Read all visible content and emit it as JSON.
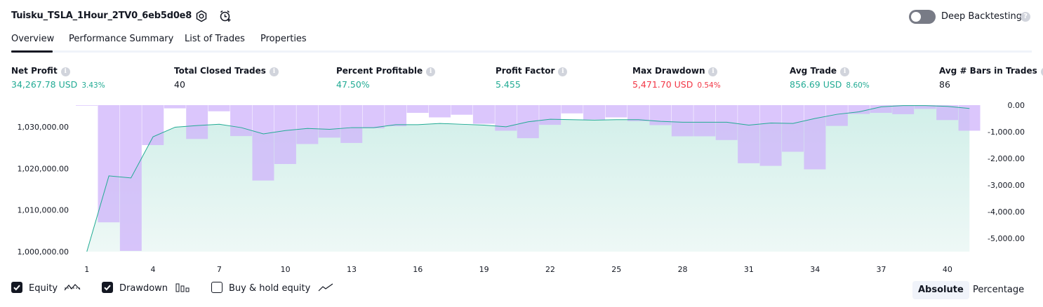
{
  "header": {
    "strategy_title": "Tuisku_TSLA_1Hour_2TV0_6eb5d0e8",
    "deep_backtesting_label": "Deep Backtesting",
    "deep_backtesting_on": false,
    "help_glyph": "?"
  },
  "tabs": [
    {
      "label": "Overview",
      "active": true
    },
    {
      "label": "Performance Summary",
      "active": false
    },
    {
      "label": "List of Trades",
      "active": false
    },
    {
      "label": "Properties",
      "active": false
    }
  ],
  "metrics": [
    {
      "label": "Net Profit",
      "value": "34,267.78 USD",
      "sub": "3.43%",
      "tone": "green"
    },
    {
      "label": "Total Closed Trades",
      "value": "40",
      "sub": "",
      "tone": "neutral"
    },
    {
      "label": "Percent Profitable",
      "value": "47.50%",
      "sub": "",
      "tone": "green"
    },
    {
      "label": "Profit Factor",
      "value": "5.455",
      "sub": "",
      "tone": "green"
    },
    {
      "label": "Max Drawdown",
      "value": "5,471.70 USD",
      "sub": "0.54%",
      "tone": "red"
    },
    {
      "label": "Avg Trade",
      "value": "856.69 USD",
      "sub": "8.60%",
      "tone": "green"
    },
    {
      "label": "Avg # Bars in Trades",
      "value": "86",
      "sub": "",
      "tone": "neutral"
    }
  ],
  "info_glyph": "i",
  "chart_data": {
    "type": "area",
    "left_axis": {
      "ticks": [
        "1,030,000.00",
        "1,020,000.00",
        "1,010,000.00",
        "1,000,000.00"
      ],
      "tick_values": [
        1030000,
        1020000,
        1010000,
        1000000
      ],
      "range": [
        1000000,
        1035200
      ]
    },
    "right_axis": {
      "ticks": [
        "0.00",
        "-1,000.00",
        "-2,000.00",
        "-3,000.00",
        "-4,000.00",
        "-5,000.00"
      ],
      "tick_values": [
        0,
        -1000,
        -2000,
        -3000,
        -4000,
        -5000
      ],
      "range": [
        -5500,
        0
      ]
    },
    "x_ticks": [
      "1",
      "4",
      "7",
      "10",
      "13",
      "16",
      "19",
      "22",
      "25",
      "28",
      "31",
      "34",
      "37",
      "40"
    ],
    "x_tick_values": [
      1,
      4,
      7,
      10,
      13,
      16,
      19,
      22,
      25,
      28,
      31,
      34,
      37,
      40
    ],
    "x_range": [
      0.5,
      41.5
    ],
    "series": [
      {
        "name": "Equity",
        "type": "area",
        "color": "#22ab94",
        "fill": "#d1efe9",
        "x": [
          1,
          2,
          3,
          4,
          5,
          6,
          7,
          8,
          9,
          10,
          11,
          12,
          13,
          14,
          15,
          16,
          17,
          18,
          19,
          20,
          21,
          22,
          23,
          24,
          25,
          26,
          27,
          28,
          29,
          30,
          31,
          32,
          33,
          34,
          35,
          36,
          37,
          38,
          39,
          40,
          41
        ],
        "values": [
          1000000,
          1018200,
          1017700,
          1027600,
          1029900,
          1030300,
          1030600,
          1029800,
          1028300,
          1029100,
          1029600,
          1029400,
          1029800,
          1029800,
          1030500,
          1030500,
          1030800,
          1030600,
          1030400,
          1030000,
          1031200,
          1031800,
          1031700,
          1031600,
          1031700,
          1031700,
          1031300,
          1031100,
          1031100,
          1031100,
          1030400,
          1030900,
          1030800,
          1032000,
          1033000,
          1033600,
          1034800,
          1035100,
          1035100,
          1034900,
          1034400
        ]
      },
      {
        "name": "Drawdown",
        "type": "bar",
        "color": "#cfb3fb",
        "x": [
          1,
          2,
          3,
          4,
          5,
          6,
          7,
          8,
          9,
          10,
          11,
          12,
          13,
          14,
          15,
          16,
          17,
          18,
          19,
          20,
          21,
          22,
          23,
          24,
          25,
          26,
          27,
          28,
          29,
          30,
          31,
          32,
          33,
          34,
          35,
          36,
          37,
          38,
          39,
          40,
          41
        ],
        "values": [
          -20,
          -4400,
          -5471.7,
          -1500,
          -120,
          -1270,
          -230,
          -1160,
          -2830,
          -2210,
          -1460,
          -1220,
          -1420,
          -870,
          -790,
          -290,
          -460,
          -360,
          -700,
          -960,
          -1240,
          -740,
          -310,
          -540,
          -460,
          -600,
          -750,
          -1170,
          -1170,
          -1310,
          -2180,
          -2280,
          -1750,
          -2410,
          -780,
          -330,
          -290,
          -340,
          -140,
          -560,
          -960
        ]
      }
    ]
  },
  "legend": [
    {
      "label": "Equity",
      "checked": true,
      "icon": "equity-line-icon"
    },
    {
      "label": "Drawdown",
      "checked": true,
      "icon": "drawdown-bars-icon"
    },
    {
      "label": "Buy & hold equity",
      "checked": false,
      "icon": "buy-hold-line-icon"
    }
  ],
  "view_modes": [
    {
      "label": "Absolute",
      "active": true
    },
    {
      "label": "Percentage",
      "active": false
    }
  ]
}
